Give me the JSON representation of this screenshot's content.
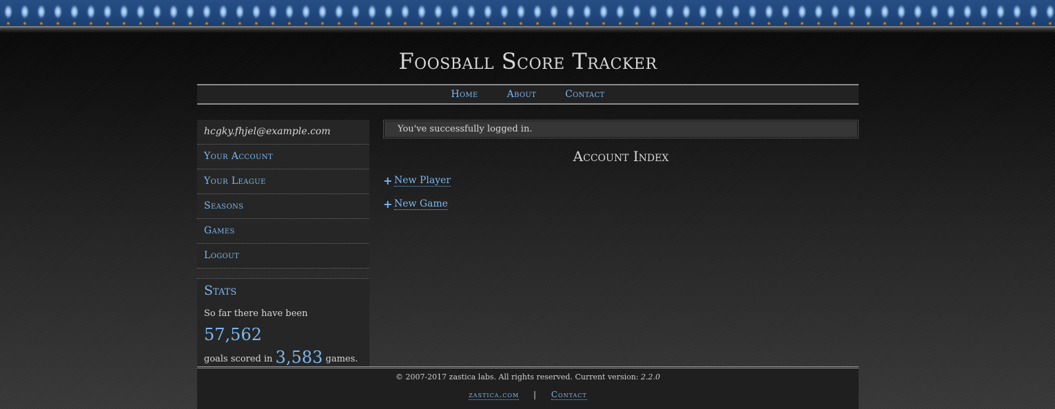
{
  "site": {
    "title": "Foosball Score Tracker"
  },
  "nav": {
    "items": [
      {
        "label": "Home"
      },
      {
        "label": "About"
      },
      {
        "label": "Contact"
      }
    ]
  },
  "sidebar": {
    "email": "hcgky.fhjel@example.com",
    "items": [
      {
        "label": "Your Account"
      },
      {
        "label": "Your League"
      },
      {
        "label": "Seasons"
      },
      {
        "label": "Games"
      },
      {
        "label": "Logout"
      }
    ],
    "stats": {
      "title": "Stats",
      "prefix": "So far there have been",
      "goals": "57,562",
      "middle": "goals scored in",
      "games": "3,583",
      "suffix": "games."
    }
  },
  "main": {
    "flash": "You've successfully logged in.",
    "heading": "Account Index",
    "actions": [
      {
        "icon": "plus-icon",
        "label": "New Player"
      },
      {
        "icon": "plus-icon",
        "label": "New Game"
      }
    ]
  },
  "footer": {
    "copyright": "© 2007-2017 zastica labs. All rights reserved. Current version:",
    "version": "2.2.0",
    "links": [
      {
        "label": "zastica.com"
      },
      {
        "label": "Contact"
      }
    ],
    "separator": "|"
  },
  "colors": {
    "link": "#7ab8f0",
    "panel": "#262626",
    "banner": "#1f4f8c"
  }
}
